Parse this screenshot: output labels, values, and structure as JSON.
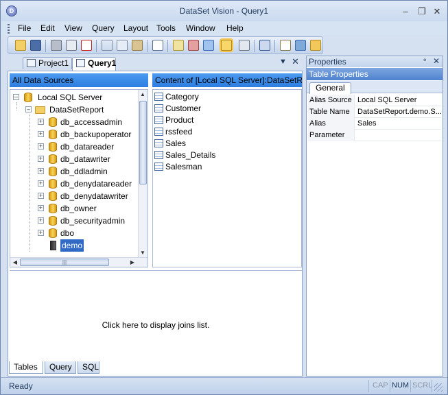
{
  "window": {
    "title": "DataSet Vision - Query1"
  },
  "menu": [
    "File",
    "Edit",
    "View",
    "Query",
    "Layout",
    "Tools",
    "Window",
    "Help"
  ],
  "toolbar": {
    "icons": [
      "open-folder-icon",
      "save-icon",
      "print-icon",
      "print-preview-icon",
      "pdf-icon",
      "cut-icon",
      "copy-icon",
      "paste-icon",
      "help-icon",
      "execute-icon",
      "stop-icon",
      "export-icon",
      "properties-icon",
      "designer-icon",
      "view-icon",
      "new-report-icon",
      "datasource-icon",
      "package-icon"
    ]
  },
  "doc_tabs": [
    {
      "label": "Project1",
      "active": false
    },
    {
      "label": "Query1",
      "active": true
    }
  ],
  "data_sources": {
    "header": "All Data Sources",
    "server": "Local SQL Server",
    "database": "DataSetReport",
    "schemas": [
      "db_accessadmin",
      "db_backupoperator",
      "db_datareader",
      "db_datawriter",
      "db_ddladmin",
      "db_denydatareader",
      "db_denydatawriter",
      "db_owner",
      "db_securityadmin",
      "dbo"
    ],
    "selected": "demo"
  },
  "content": {
    "header": "Content of [Local SQL Server]:DataSetReport",
    "tables": [
      "Category",
      "Customer",
      "Product",
      "rssfeed",
      "Sales",
      "Sales_Details",
      "Salesman"
    ]
  },
  "joins": {
    "text": "Click here to display joins list."
  },
  "bottom_tabs": [
    {
      "label": "Tables",
      "active": true
    },
    {
      "label": "Query",
      "active": false
    },
    {
      "label": "SQL",
      "active": false
    }
  ],
  "properties": {
    "title": "Properties",
    "subtitle": "Table Properties",
    "tab": "General",
    "rows": [
      {
        "key": "Alias Source",
        "value": "Local SQL Server"
      },
      {
        "key": "Table Name",
        "value": "DataSetReport.demo.S..."
      },
      {
        "key": "Alias",
        "value": "Sales"
      },
      {
        "key": "Parameter",
        "value": ""
      }
    ]
  },
  "status": {
    "text": "Ready",
    "indicators": [
      {
        "label": "CAP",
        "on": false
      },
      {
        "label": "NUM",
        "on": true
      },
      {
        "label": "SCRL",
        "on": false
      }
    ]
  },
  "colors": {
    "accent": "#316ac5",
    "header_blue": "#3f8fe8",
    "frame": "#8aa0c4"
  }
}
